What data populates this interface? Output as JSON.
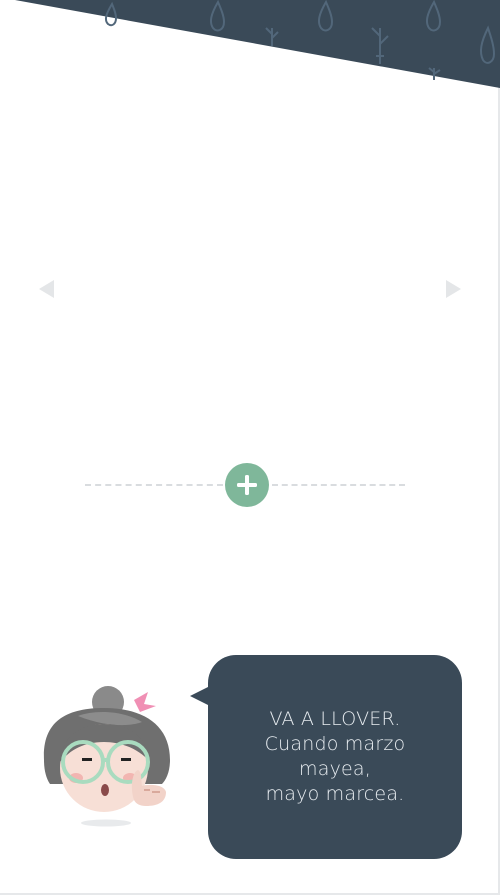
{
  "colors": {
    "banner": "#3a4a58",
    "accent": "#7fb79a",
    "bubble": "#3a4a58",
    "bubble_text": "#e8edf1",
    "arrow": "#e4e6e8"
  },
  "icons": {
    "banner_pattern": "raindrops-and-sprouts",
    "prev": "triangle-left-icon",
    "next": "triangle-right-icon",
    "add": "plus-icon"
  },
  "speech": {
    "line1": "VA A LLOVER.",
    "line2": "Cuando marzo",
    "line3": "mayea,",
    "line4": "mayo marcea."
  }
}
